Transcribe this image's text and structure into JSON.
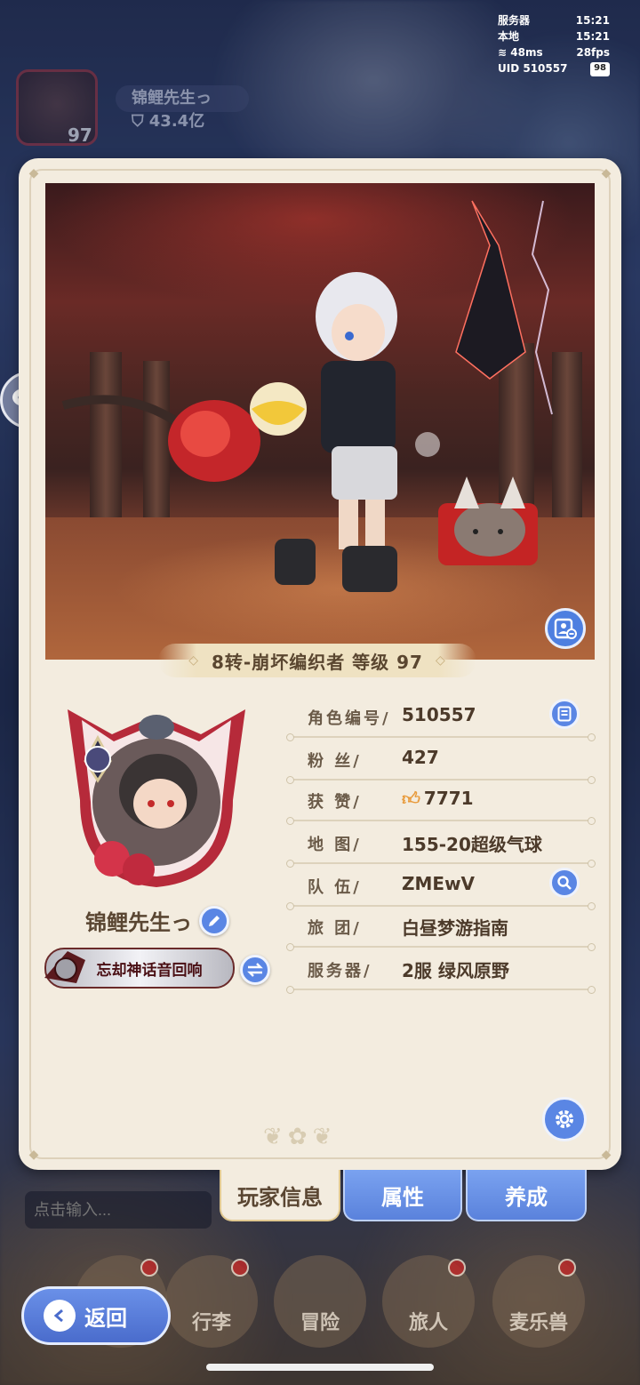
{
  "status": {
    "server_label": "服务器",
    "server_time": "15:21",
    "local_label": "本地",
    "local_time": "15:21",
    "ping": "48ms",
    "fps": "28fps",
    "uid_label": "UID",
    "uid": "510557",
    "battery": "98"
  },
  "background_chip": {
    "name": "锦鲤先生っ",
    "power": "43.4亿",
    "level": "97"
  },
  "class_banner": {
    "text": "8转-崩坏编织者 等级 97"
  },
  "player": {
    "name": "锦鲤先生っ",
    "title": "忘却神话音回响"
  },
  "info": [
    {
      "label": "角色编号/",
      "value": "510557",
      "action_icon": "list-icon"
    },
    {
      "label": "粉  丝/",
      "value": "427"
    },
    {
      "label": "获  赞/",
      "value": "7771",
      "icon": "thumbs-up-icon"
    },
    {
      "label": "地  图/",
      "value": "155-20超级气球"
    },
    {
      "label": "队  伍/",
      "value": "ZMEwV",
      "action_icon": "search-icon"
    },
    {
      "label": "旅  团/",
      "value": "白昼梦游指南"
    },
    {
      "label": "服务器/",
      "value": "2服 绿风原野"
    }
  ],
  "tabs": [
    {
      "label": "玩家信息",
      "active": true
    },
    {
      "label": "属性",
      "active": false
    },
    {
      "label": "养成",
      "active": false
    }
  ],
  "chat": {
    "placeholder": "点击输入..."
  },
  "nav": {
    "back": "返回",
    "items": [
      "行李",
      "冒险",
      "旅人",
      "麦乐兽"
    ]
  },
  "colors": {
    "accent": "#5a86e4",
    "card": "#f3ecdf",
    "text_brown": "#5a4632"
  }
}
